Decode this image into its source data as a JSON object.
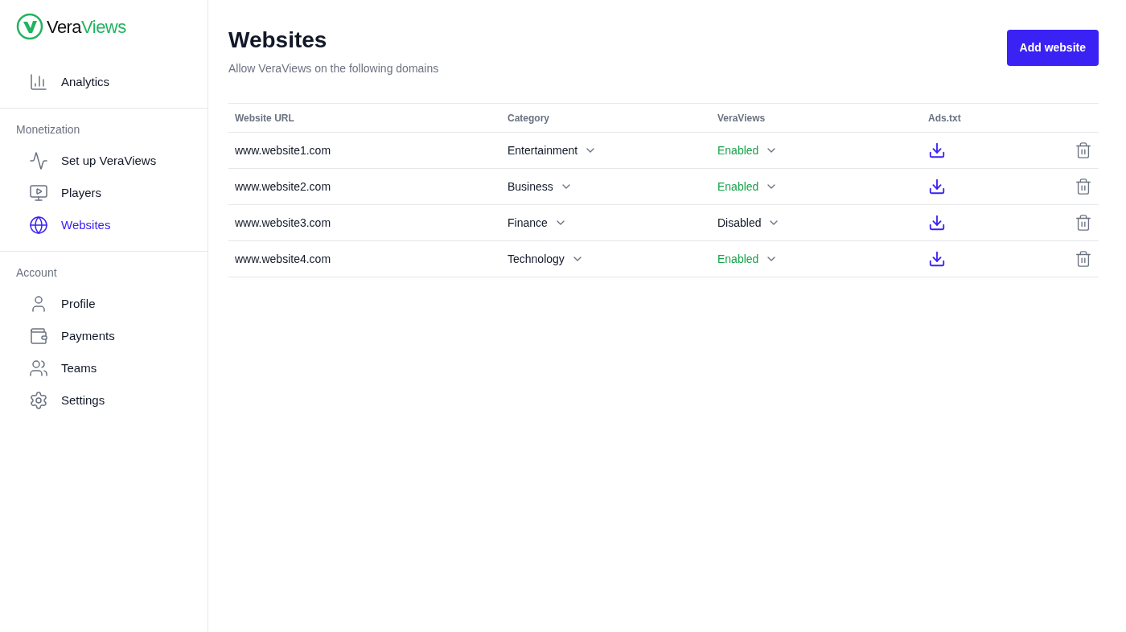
{
  "logo": {
    "part_1": "Vera",
    "part_2": "Views"
  },
  "sidebar": {
    "top_items": [
      {
        "label": "Analytics",
        "selected": false
      }
    ],
    "sections": [
      {
        "heading": "Monetization",
        "items": [
          {
            "label": "Set up VeraViews",
            "selected": false
          },
          {
            "label": "Players",
            "selected": false
          },
          {
            "label": "Websites",
            "selected": true
          }
        ]
      },
      {
        "heading": "Account",
        "items": [
          {
            "label": "Profile",
            "selected": false
          },
          {
            "label": "Payments",
            "selected": false
          },
          {
            "label": "Teams",
            "selected": false
          },
          {
            "label": "Settings",
            "selected": false
          }
        ]
      }
    ]
  },
  "page": {
    "title": "Websites",
    "subtitle": "Allow VeraViews on the following domains",
    "add_button": "Add website"
  },
  "table": {
    "columns": [
      "Website URL",
      "Category",
      "VeraViews",
      "Ads.txt"
    ],
    "rows": [
      {
        "url": "www.website1.com",
        "category": "Entertainment",
        "status": "Enabled",
        "enabled": true
      },
      {
        "url": "www.website2.com",
        "category": "Business",
        "status": "Enabled",
        "enabled": true
      },
      {
        "url": "www.website3.com",
        "category": "Finance",
        "status": "Disabled",
        "enabled": false
      },
      {
        "url": "www.website4.com",
        "category": "Technology",
        "status": "Enabled",
        "enabled": true
      }
    ]
  }
}
